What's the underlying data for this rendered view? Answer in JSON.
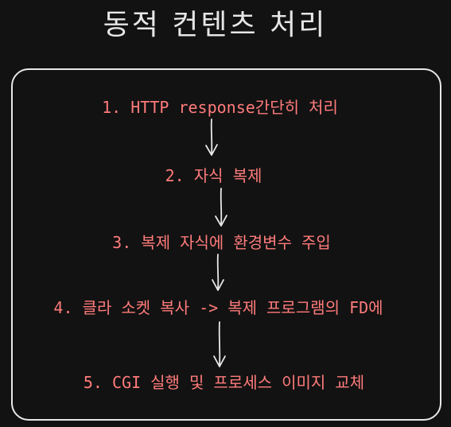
{
  "title": "동적 컨텐츠 처리",
  "steps": [
    "1. HTTP response간단히 처리",
    "2. 자식 복제",
    "3. 복제 자식에 환경변수 주입",
    "4. 클라 소켓 복사 -> 복제 프로그램의 FD에",
    "5. CGI 실행 및 프로세스 이미지 교체"
  ],
  "colors": {
    "background": "#121212",
    "title": "#e6e6e6",
    "step_text": "#ff7b7b",
    "lines": "#e8e8e8"
  }
}
